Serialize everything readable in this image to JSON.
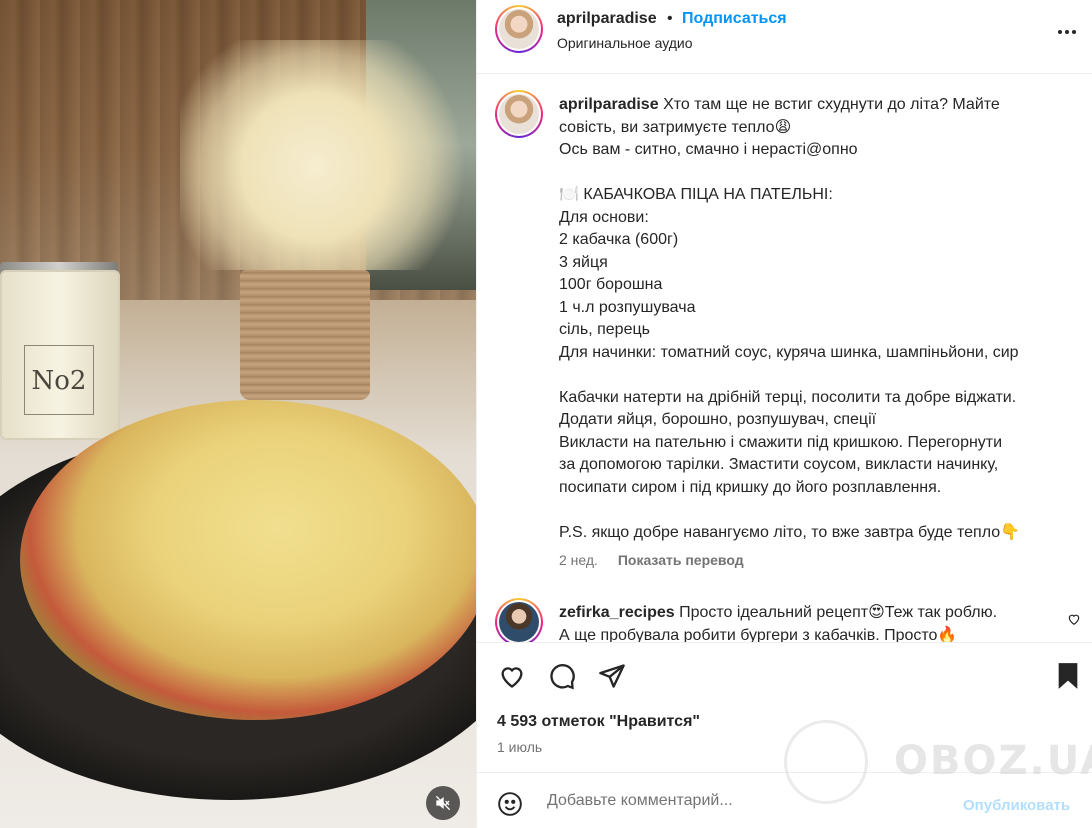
{
  "photo": {
    "candle_label": "No2"
  },
  "header": {
    "username": "aprilparadise",
    "separator": "•",
    "follow_label": "Подписаться",
    "subtitle": "Оригинальное аудио"
  },
  "caption": {
    "username": "aprilparadise",
    "lines": [
      "Хто там ще не встиг схуднути до літа? Майте",
      "совість, ви затримуєте тепло😩",
      "Ось вам - ситно, смачно і нерасті@опно",
      "",
      "🍽️ КАБАЧКОВА ПІЦА НА ПАТЕЛЬНІ:",
      "Для основи:",
      "2 кабачка (600г)",
      "3 яйця",
      "100г борошна",
      "1 ч.л розпушувача",
      "сіль, перець",
      "Для начинки: томатний соус, куряча шинка, шампіньйони, сир",
      "",
      "Кабачки натерти на дрібній терці, посолити та добре віджати.",
      "Додати яйця, борошно, розпушувач, спеції",
      "Викласти на пательню і смажити під кришкою. Перегорнути",
      "за допомогою тарілки. Змастити соусом, викласти начинку,",
      "посипати сиром і під кришку до його розплавлення.",
      "",
      "P.S. якщо добре навангуємо літо, то вже завтра буде тепло👇"
    ],
    "age": "2 нед.",
    "translate_label": "Показать перевод"
  },
  "comment": {
    "username": "zefirka_recipes",
    "line1": "Просто ідеальний рецепт😍Теж так роблю.",
    "line2": "А ще пробувала робити бургери з кабачків. Просто🔥"
  },
  "actions": {
    "likes": "4 593 отметок \"Нравится\"",
    "date": "1 июль"
  },
  "add_comment": {
    "placeholder": "Добавьте комментарий...",
    "publish_label": "Опубликовать"
  },
  "watermark": {
    "text": "OBOZ.UA"
  },
  "colors": {
    "link": "#0095f6",
    "muted": "#737373",
    "publish_disabled": "#b2dffc"
  }
}
